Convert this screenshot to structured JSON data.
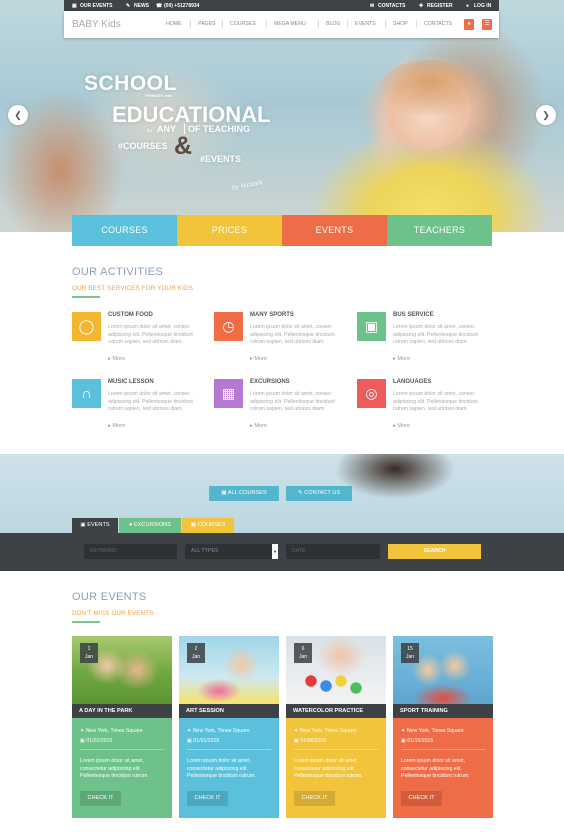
{
  "topbar": {
    "our_events": "OUR EVENTS",
    "news": "NEWS",
    "phone": "(00) +51278934",
    "contacts": "CONTACTS",
    "register": "REGISTER",
    "login": "LOG IN"
  },
  "nav": {
    "logo": "BABY Kids",
    "items": [
      "HOME",
      "PAGES",
      "COURSES",
      "MEGA MENU",
      "BLOG",
      "EVENTS",
      "SHOP",
      "CONTACTS"
    ]
  },
  "hero": {
    "line1": "SCHOOL",
    "small1": "PRIMARY side",
    "line2": "EDUCATIONAL",
    "for": "for",
    "any": "ANY",
    "of_teaching": "OF TEACHING",
    "courses": "#COURSES",
    "amp": "&",
    "events": "#EVENTS",
    "signature": "by Nicdark"
  },
  "tiles": [
    "COURSES",
    "PRICES",
    "EVENTS",
    "TEACHERS"
  ],
  "activities": {
    "title": "OUR ACTIVITIES",
    "subtitle": "OUR BEST SERVICES FOR YOUR KIDS",
    "more": "More",
    "items": [
      {
        "title": "CUSTOM FOOD",
        "icon": "apple-icon",
        "color": "#f2b631",
        "desc": "Lorem ipsum dolor sit amet, consec adipiscing elit. Pellentesque tincidunt rutrum sapien, sed ultrices diam."
      },
      {
        "title": "MANY SPORTS",
        "icon": "stopwatch-icon",
        "color": "#ef6d46",
        "desc": "Lorem ipsum dolor sit amet, consec adipiscing elit. Pellentesque tincidunt rutrum sapien, sed ultrices diam."
      },
      {
        "title": "BUS SERVICE",
        "icon": "bus-icon",
        "color": "#6cc28a",
        "desc": "Lorem ipsum dolor sit amet, consec adipiscing elit. Pellentesque tincidunt rutrum sapien, sed ultrices diam."
      },
      {
        "title": "MUSIC LESSON",
        "icon": "headphones-icon",
        "color": "#5bc0dc",
        "desc": "Lorem ipsum dolor sit amet, consec adipiscing elit. Pellentesque tincidunt rutrum sapien, sed ultrices diam."
      },
      {
        "title": "EXCURSIONS",
        "icon": "map-icon",
        "color": "#b57ad0",
        "desc": "Lorem ipsum dolor sit amet, consec adipiscing elit. Pellentesque tincidunt rutrum sapien, sed ultrices diam."
      },
      {
        "title": "LANGUAGES",
        "icon": "globe-icon",
        "color": "#ee5b5b",
        "desc": "Lorem ipsum dolor sit amet, consec adipiscing elit. Pellentesque tincidunt rutrum sapien, sed ultrices diam."
      }
    ]
  },
  "band": {
    "all_courses": "ALL COURSES",
    "contact_us": "CONTACT US"
  },
  "search_tabs": [
    {
      "label": "EVENTS",
      "color": "#3e4246"
    },
    {
      "label": "EXCURSIONS",
      "color": "#6cc28a"
    },
    {
      "label": "COURSES",
      "color": "#f2c43c"
    }
  ],
  "search": {
    "keyword": "KEYWORD",
    "types": "ALL TYPES",
    "date": "DATE",
    "button": "SEARCH"
  },
  "events": {
    "title": "OUR EVENTS",
    "subtitle": "DON'T MISS OUR EVENTS",
    "check": "CHECK IT",
    "items": [
      {
        "day": "1",
        "month": "Jan",
        "title": "A DAY IN THE PARK",
        "location": "New York, Times Square",
        "date": "01/01/2015",
        "color": "#6cc28a",
        "desc": "Lorem ipsum dolor sit amet, consectetur adipiscing elit. Pellentesque tincidunt rutrum."
      },
      {
        "day": "2",
        "month": "Jan",
        "title": "ART SESSION",
        "location": "New York, Times Square",
        "date": "01/01/2015",
        "color": "#5bc0dc",
        "desc": "Lorem ipsum dolor sit amet, consectetur adipiscing elit. Pellentesque tincidunt rutrum."
      },
      {
        "day": "6",
        "month": "Jan",
        "title": "WATERCOLOR PRACTICE",
        "location": "New York, Times Square",
        "date": "01/06/2015",
        "color": "#f2c43c",
        "desc": "Lorem ipsum dolor sit amet, consectetur adipiscing elit. Pellentesque tincidunt rutrum."
      },
      {
        "day": "15",
        "month": "Jan",
        "title": "SPORT TRAINING",
        "location": "New York, Times Square",
        "date": "01/15/2015",
        "color": "#ef6d46",
        "desc": "Lorem ipsum dolor sit amet, consectetur adipiscing elit. Pellentesque tincidunt rutrum."
      }
    ]
  }
}
